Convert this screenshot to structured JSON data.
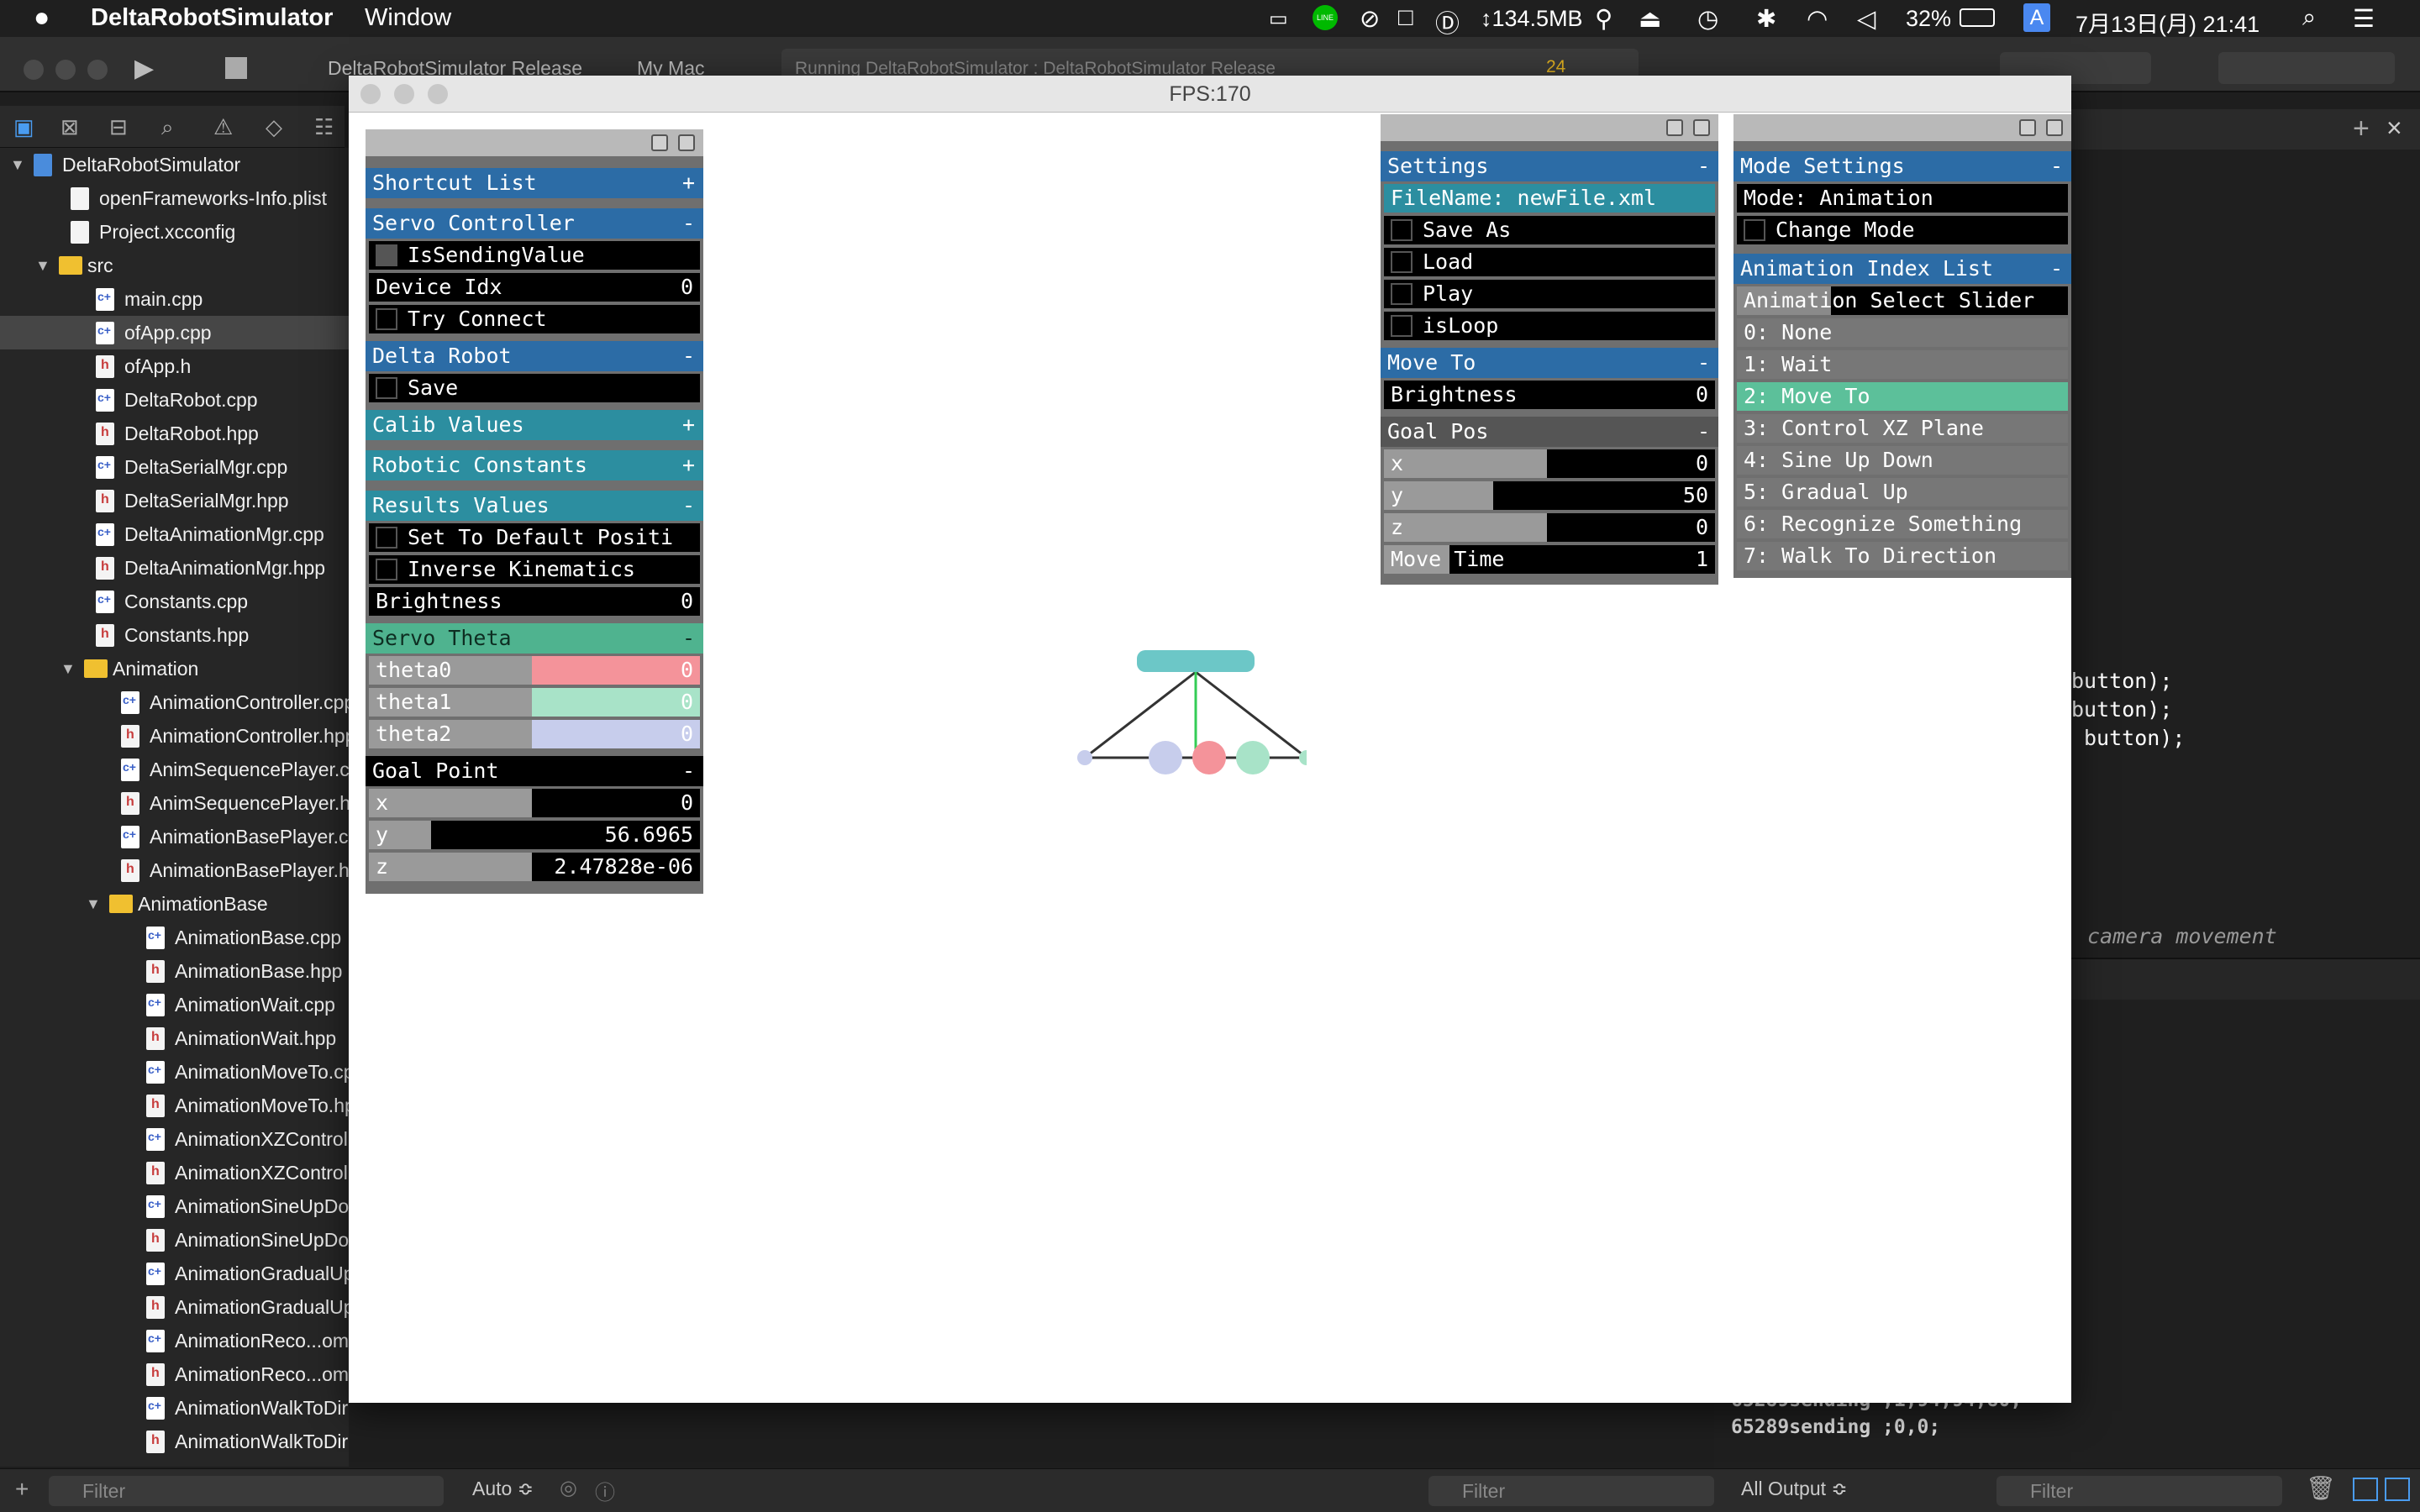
{
  "menubar": {
    "apple": "",
    "app_name": "DeltaRobotSimulator",
    "menu_window": "Window",
    "memory": "↕134.5MB",
    "battery": "32%",
    "input": "A",
    "datetime": "7月13日(月)  21:41"
  },
  "xcode": {
    "scheme": "DeltaRobotSimulator Release",
    "destination": "My Mac",
    "status": "Running DeltaRobotSimulator : DeltaRobotSimulator Release",
    "warnings": "24"
  },
  "navigator": {
    "items": [
      {
        "label": "DeltaRobotSimulator",
        "type": "proj",
        "depth": 0,
        "open": true
      },
      {
        "label": "openFrameworks-Info.plist",
        "type": "file",
        "depth": 1
      },
      {
        "label": "Project.xcconfig",
        "type": "file",
        "depth": 1
      },
      {
        "label": "src",
        "type": "folder",
        "depth": 1,
        "open": true
      },
      {
        "label": "main.cpp",
        "type": "cpp",
        "depth": 2
      },
      {
        "label": "ofApp.cpp",
        "type": "cpp",
        "depth": 2,
        "selected": true
      },
      {
        "label": "ofApp.h",
        "type": "h",
        "depth": 2
      },
      {
        "label": "DeltaRobot.cpp",
        "type": "cpp",
        "depth": 2
      },
      {
        "label": "DeltaRobot.hpp",
        "type": "h",
        "depth": 2
      },
      {
        "label": "DeltaSerialMgr.cpp",
        "type": "cpp",
        "depth": 2
      },
      {
        "label": "DeltaSerialMgr.hpp",
        "type": "h",
        "depth": 2
      },
      {
        "label": "DeltaAnimationMgr.cpp",
        "type": "cpp",
        "depth": 2
      },
      {
        "label": "DeltaAnimationMgr.hpp",
        "type": "h",
        "depth": 2
      },
      {
        "label": "Constants.cpp",
        "type": "cpp",
        "depth": 2
      },
      {
        "label": "Constants.hpp",
        "type": "h",
        "depth": 2
      },
      {
        "label": "Animation",
        "type": "folder",
        "depth": 2,
        "open": true
      },
      {
        "label": "AnimationController.cpp",
        "type": "cpp",
        "depth": 3
      },
      {
        "label": "AnimationController.hpp",
        "type": "h",
        "depth": 3
      },
      {
        "label": "AnimSequencePlayer.cpp",
        "type": "cpp",
        "depth": 3
      },
      {
        "label": "AnimSequencePlayer.hpp",
        "type": "h",
        "depth": 3
      },
      {
        "label": "AnimationBasePlayer.cpp",
        "type": "cpp",
        "depth": 3
      },
      {
        "label": "AnimationBasePlayer.hpp",
        "type": "h",
        "depth": 3
      },
      {
        "label": "AnimationBase",
        "type": "folder",
        "depth": 3,
        "open": true
      },
      {
        "label": "AnimationBase.cpp",
        "type": "cpp",
        "depth": 4
      },
      {
        "label": "AnimationBase.hpp",
        "type": "h",
        "depth": 4
      },
      {
        "label": "AnimationWait.cpp",
        "type": "cpp",
        "depth": 4
      },
      {
        "label": "AnimationWait.hpp",
        "type": "h",
        "depth": 4
      },
      {
        "label": "AnimationMoveTo.cpp",
        "type": "cpp",
        "depth": 4
      },
      {
        "label": "AnimationMoveTo.hpp",
        "type": "h",
        "depth": 4
      },
      {
        "label": "AnimationXZControl.c",
        "type": "cpp",
        "depth": 4
      },
      {
        "label": "AnimationXZControl.h",
        "type": "h",
        "depth": 4
      },
      {
        "label": "AnimationSineUpDow",
        "type": "cpp",
        "depth": 4
      },
      {
        "label": "AnimationSineUpDow",
        "type": "h",
        "depth": 4
      },
      {
        "label": "AnimationGradualUp.c",
        "type": "cpp",
        "depth": 4
      },
      {
        "label": "AnimationGradualUp.h",
        "type": "h",
        "depth": 4
      },
      {
        "label": "AnimationReco...omet",
        "type": "cpp",
        "depth": 4
      },
      {
        "label": "AnimationReco...omet",
        "type": "h",
        "depth": 4
      },
      {
        "label": "AnimationWalkToDirection.cpp",
        "type": "cpp",
        "depth": 4
      },
      {
        "label": "AnimationWalkToDirection.hpp",
        "type": "h",
        "depth": 4
      }
    ]
  },
  "bottom": {
    "filter_placeholder": "Filter",
    "auto": "Auto ≎",
    "output": "All Output ≎"
  },
  "editor": {
    "lines": [
      "button);",
      "button);",
      "button);"
    ],
    "comment": "camera movement",
    "console": [
      "65289sending ;1,94,94,80;",
      "65289sending ;0,0;"
    ]
  },
  "app": {
    "title": "FPS:170"
  },
  "panel_left": {
    "shortcut": "Shortcut List",
    "servo": "Servo Controller",
    "is_sending": "IsSendingValue",
    "device_idx": "Device Idx",
    "device_idx_val": "0",
    "try_connect": "Try Connect",
    "delta": "Delta Robot",
    "save": "Save",
    "calib": "Calib Values",
    "robotic": "Robotic Constants",
    "results": "Results Values",
    "set_default": "Set To Default Positi",
    "ik": "Inverse Kinematics",
    "brightness": "Brightness",
    "brightness_val": "0",
    "servo_theta": "Servo Theta",
    "theta0": "theta0",
    "theta1": "theta1",
    "theta2": "theta2",
    "theta0_val": "0",
    "theta1_val": "0",
    "theta2_val": "0",
    "goal_point": "Goal Point",
    "x": "x",
    "x_val": "0",
    "y": "y",
    "y_val": "56.6965",
    "z": "z",
    "z_val": "2.47828e-06",
    "plus": "+",
    "minus": "-"
  },
  "panel_mid": {
    "settings": "Settings",
    "filename": "FileName: newFile.xml",
    "save_as": "Save As",
    "load": "Load",
    "play": "Play",
    "is_loop": "isLoop",
    "move_to": "Move To",
    "brightness": "Brightness",
    "brightness_val": "0",
    "goal_pos": "Goal Pos",
    "x": "x",
    "x_val": "0",
    "y": "y",
    "y_val": "50",
    "z": "z",
    "z_val": "0",
    "move_time": "Move Time",
    "move_time_val": "1",
    "minus": "-"
  },
  "panel_right": {
    "mode_settings": "Mode Settings",
    "mode": "Mode: Animation",
    "change_mode": "Change Mode",
    "anim_list": "Animation Index List",
    "slider": "Animation Select Slider",
    "minus": "-",
    "items": [
      "0: None",
      "1: Wait",
      "2: Move To",
      "3: Control XZ Plane",
      "4: Sine Up Down",
      "5: Gradual Up",
      "6: Recognize Something",
      "7: Walk To Direction"
    ],
    "selected_index": 2
  },
  "colors": {
    "group_blue": "#2c6ca6",
    "group_teal": "#2c8ea0",
    "group_green": "#4fb38f",
    "theta0": "#f4939a",
    "theta1": "#a8e3c8",
    "theta2": "#c7cdec"
  }
}
